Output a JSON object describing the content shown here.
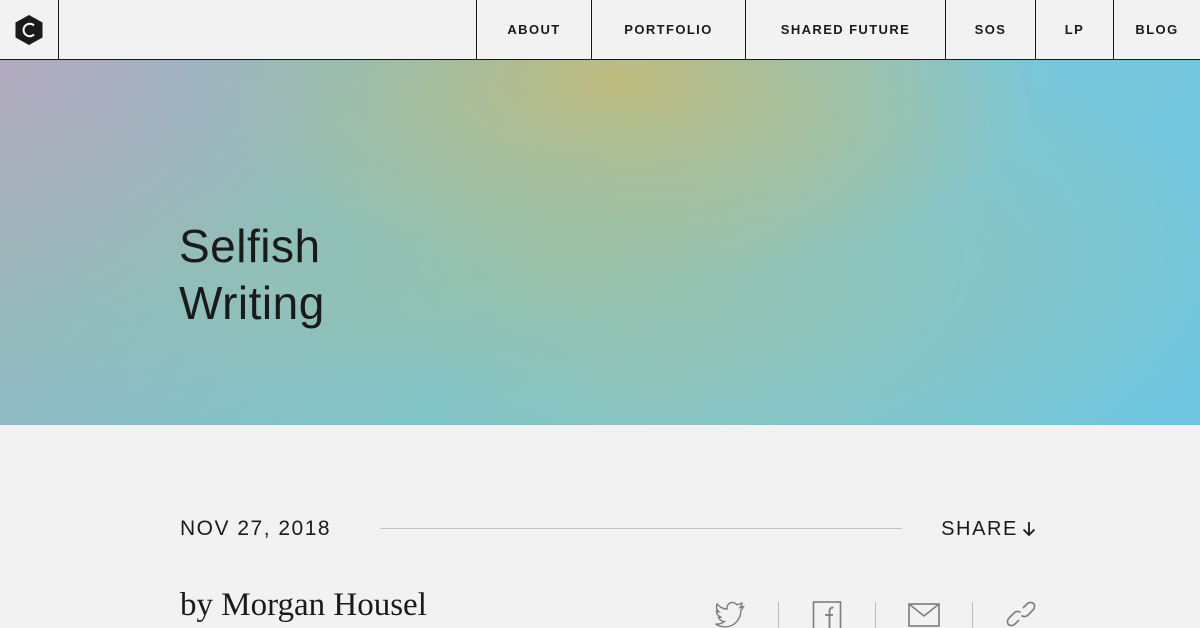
{
  "header": {
    "logo_icon": "hexagon-c-logo",
    "nav": [
      {
        "label": "ABOUT"
      },
      {
        "label": "PORTFOLIO"
      },
      {
        "label": "SHARED FUTURE"
      },
      {
        "label": "SOS"
      },
      {
        "label": "LP"
      },
      {
        "label": "BLOG"
      }
    ]
  },
  "hero": {
    "title_line1": "Selfish",
    "title_line2": "Writing"
  },
  "article": {
    "date": "NOV 27, 2018",
    "share_label": "SHARE",
    "share_icon": "arrow-down-icon",
    "byline": "by Morgan Housel",
    "share_targets": [
      "twitter-icon",
      "facebook-icon",
      "email-icon",
      "link-icon"
    ]
  },
  "colors": {
    "text": "#1a1a1a",
    "background": "#f2f2f2",
    "hero_blue": "#6ec6e0",
    "hero_gold": "#c3ba78"
  }
}
